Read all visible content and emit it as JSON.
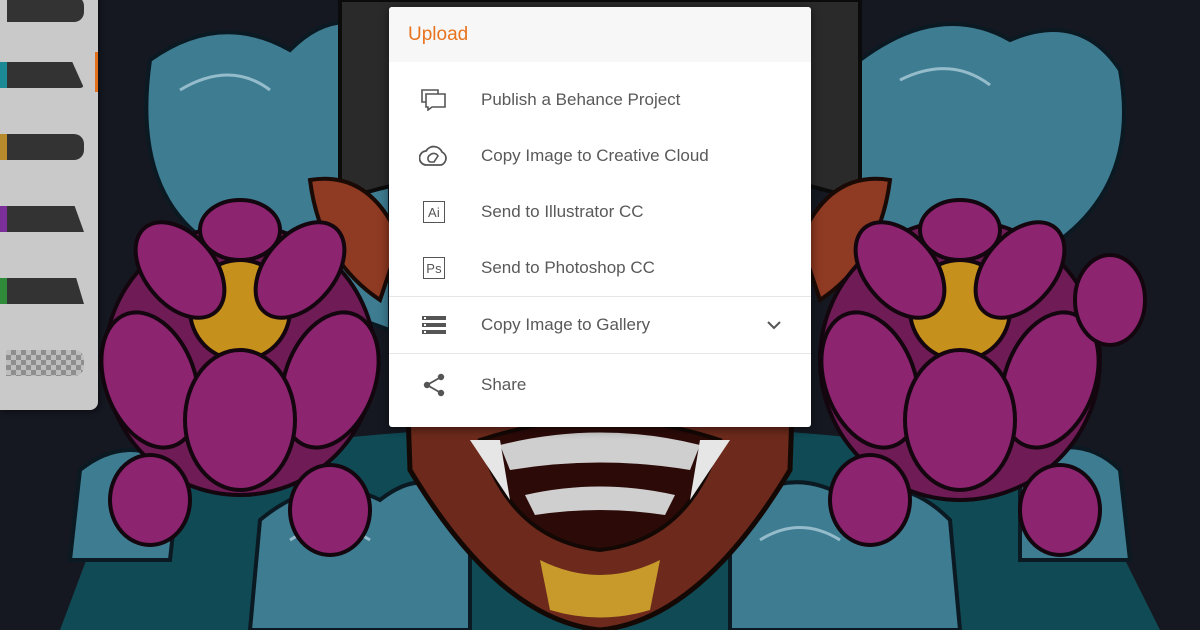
{
  "colors": {
    "accent": "#e8731e",
    "text": "#595959",
    "dialog_bg": "#ffffff",
    "header_bg": "#f7f7f7",
    "canvas_bg": "#151821"
  },
  "dialog": {
    "title": "Upload",
    "items": [
      {
        "label": "Publish a Behance Project",
        "icon": "behance-comment-icon"
      },
      {
        "label": "Copy Image to Creative Cloud",
        "icon": "creative-cloud-icon"
      },
      {
        "label": "Send to Illustrator CC",
        "icon": "illustrator-icon",
        "icon_text": "Ai"
      },
      {
        "label": "Send to Photoshop CC",
        "icon": "photoshop-icon",
        "icon_text": "Ps"
      },
      {
        "label": "Copy Image to Gallery",
        "icon": "gallery-list-icon",
        "has_dropdown": true
      },
      {
        "label": "Share",
        "icon": "share-icon"
      }
    ]
  },
  "brush_panel": {
    "brushes": [
      {
        "name": "brush-1",
        "color": "#c9c9c9"
      },
      {
        "name": "brush-2",
        "color": "#1b8a94",
        "selected": true
      },
      {
        "name": "brush-3",
        "color": "#b78a2c"
      },
      {
        "name": "brush-4",
        "color": "#7a2f9a"
      },
      {
        "name": "brush-5",
        "color": "#2f8a3a"
      },
      {
        "name": "eraser",
        "color": "transparent"
      }
    ]
  }
}
